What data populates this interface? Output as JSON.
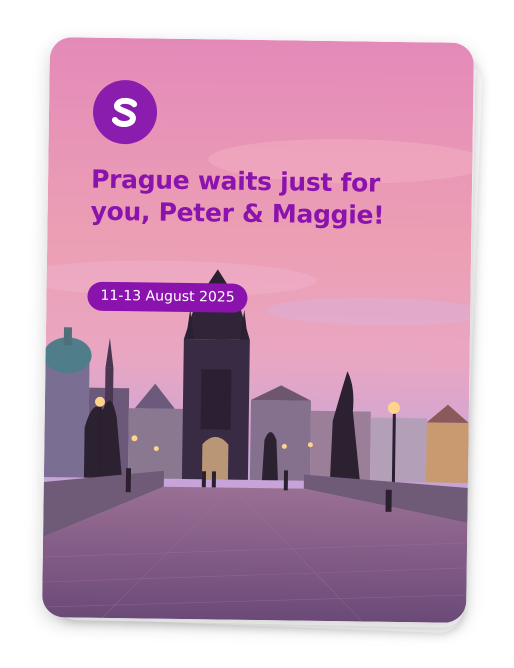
{
  "card": {
    "logo_letter": "S",
    "headline": "Prague waits just for you, Peter & Maggie!",
    "date_badge": "11-13 August 2025"
  },
  "colors": {
    "brand_purple": "#8b13ad",
    "sky_top": "#e58fb8",
    "sky_bottom": "#c9a0d8",
    "bridge": "#7e5a86"
  },
  "icons": [
    "brand-logo-icon",
    "stacked-cards"
  ]
}
